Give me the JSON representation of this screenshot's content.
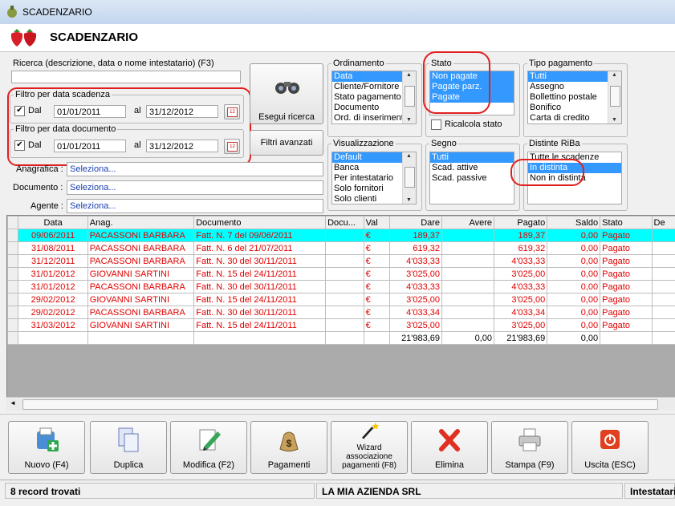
{
  "window": {
    "title": "SCADENZARIO"
  },
  "header": {
    "title": "SCADENZARIO"
  },
  "search": {
    "label": "Ricerca (descrizione, data o nome intestatario) (F3)",
    "value": ""
  },
  "filter_scadenza": {
    "legend": "Filtro per data scadenza",
    "checked": true,
    "from_label": "Dal",
    "from": "01/01/2011",
    "to_label": "al",
    "to": "31/12/2012"
  },
  "filter_documento": {
    "legend": "Filtro per data documento",
    "checked": true,
    "from_label": "Dal",
    "from": "01/01/2011",
    "to_label": "al",
    "to": "31/12/2012"
  },
  "buttons": {
    "search": "Esegui ricerca",
    "advanced": "Filtri avanzati"
  },
  "ordinamento": {
    "legend": "Ordinamento",
    "items": [
      "Data",
      "Cliente/Fornitore",
      "Stato pagamento",
      "Documento",
      "Ord. di inserimento"
    ],
    "selected": 0
  },
  "stato": {
    "legend": "Stato",
    "items": [
      "Non pagate",
      "Pagate parz.",
      "Pagate"
    ],
    "selected": [
      0,
      1,
      2
    ],
    "recalc_label": "Ricalcola stato",
    "recalc_checked": false
  },
  "tipo_pagamento": {
    "legend": "Tipo pagamento",
    "items": [
      "Tutti",
      "Assegno",
      "Bollettino postale",
      "Bonifico",
      "Carta di credito"
    ],
    "selected": 0
  },
  "visualizzazione": {
    "legend": "Visualizzazione",
    "items": [
      "Default",
      "Banca",
      "Per intestatario",
      "Solo fornitori",
      "Solo clienti"
    ],
    "selected": 0
  },
  "segno": {
    "legend": "Segno",
    "items": [
      "Tutti",
      "Scad. attive",
      "Scad. passive"
    ],
    "selected": 0
  },
  "distinte": {
    "legend": "Distinte RiBa",
    "items": [
      "Tutte le scadenze",
      "In distinta",
      "Non in distinta"
    ],
    "selected": 1
  },
  "anagrafica": {
    "label": "Anagrafica :",
    "value": "Seleziona..."
  },
  "documento": {
    "label": "Documento :",
    "value": "Seleziona..."
  },
  "agente": {
    "label": "Agente :",
    "value": "Seleziona..."
  },
  "table": {
    "columns": [
      "Data",
      "Anag.",
      "Documento",
      "Docu...",
      "Val",
      "Dare",
      "Avere",
      "Pagato",
      "Saldo",
      "Stato",
      "De"
    ],
    "rows": [
      [
        "09/06/2011",
        "PACASSONI BARBARA",
        "Fatt. N. 7 del 09/06/2011",
        "",
        "€",
        "189,37",
        "",
        "189,37",
        "0,00",
        "Pagato"
      ],
      [
        "31/08/2011",
        "PACASSONI BARBARA",
        "Fatt. N. 6 del 21/07/2011",
        "",
        "€",
        "619,32",
        "",
        "619,32",
        "0,00",
        "Pagato"
      ],
      [
        "31/12/2011",
        "PACASSONI BARBARA",
        "Fatt. N. 30 del 30/11/2011",
        "",
        "€",
        "4'033,33",
        "",
        "4'033,33",
        "0,00",
        "Pagato"
      ],
      [
        "31/01/2012",
        "GIOVANNI SARTINI",
        "Fatt. N. 15 del 24/11/2011",
        "",
        "€",
        "3'025,00",
        "",
        "3'025,00",
        "0,00",
        "Pagato"
      ],
      [
        "31/01/2012",
        "PACASSONI BARBARA",
        "Fatt. N. 30 del 30/11/2011",
        "",
        "€",
        "4'033,33",
        "",
        "4'033,33",
        "0,00",
        "Pagato"
      ],
      [
        "29/02/2012",
        "GIOVANNI SARTINI",
        "Fatt. N. 15 del 24/11/2011",
        "",
        "€",
        "3'025,00",
        "",
        "3'025,00",
        "0,00",
        "Pagato"
      ],
      [
        "29/02/2012",
        "PACASSONI BARBARA",
        "Fatt. N. 30 del 30/11/2011",
        "",
        "€",
        "4'033,34",
        "",
        "4'033,34",
        "0,00",
        "Pagato"
      ],
      [
        "31/03/2012",
        "GIOVANNI SARTINI",
        "Fatt. N. 15 del 24/11/2011",
        "",
        "€",
        "3'025,00",
        "",
        "3'025,00",
        "0,00",
        "Pagato"
      ]
    ],
    "totals": [
      "",
      "",
      "",
      "",
      "",
      "21'983,69",
      "0,00",
      "21'983,69",
      "0,00",
      ""
    ]
  },
  "toolbar": [
    {
      "label": "Nuovo (F4)",
      "icon": "new-document-icon"
    },
    {
      "label": "Duplica",
      "icon": "duplicate-icon"
    },
    {
      "label": "Modifica (F2)",
      "icon": "edit-icon"
    },
    {
      "label": "Pagamenti",
      "icon": "money-bag-icon"
    },
    {
      "label": "Wizard associazione pagamenti (F8)",
      "icon": "wizard-wand-icon"
    },
    {
      "label": "Elimina",
      "icon": "delete-x-icon"
    },
    {
      "label": "Stampa (F9)",
      "icon": "printer-icon"
    },
    {
      "label": "Uscita (ESC)",
      "icon": "exit-icon"
    }
  ],
  "status": {
    "records": "8 record trovati",
    "company": "LA MIA AZIENDA SRL",
    "right": "Intestatari"
  },
  "colors": {
    "selection": "#3399ff",
    "highlight_row": "#00ffff",
    "row_text": "#e00000",
    "annotation": "#e02020"
  }
}
